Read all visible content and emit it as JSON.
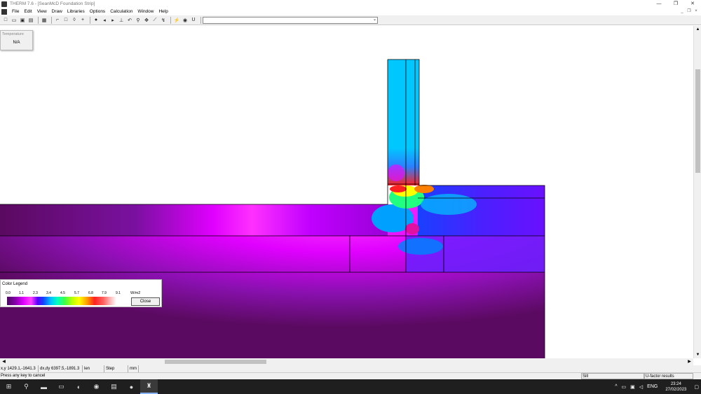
{
  "window": {
    "title": "THERM 7.6 - [SeanMcD Foundation Strip]",
    "controls": [
      "—",
      "❐",
      "✕"
    ]
  },
  "menu": {
    "items": [
      "File",
      "Edit",
      "View",
      "Draw",
      "Libraries",
      "Options",
      "Calculation",
      "Window",
      "Help"
    ],
    "mdi_controls": [
      "_",
      "❐",
      "×"
    ]
  },
  "toolbar": {
    "combo_value": ""
  },
  "temperature_popup": {
    "title": "Temperature",
    "value": "N/A"
  },
  "legend": {
    "title": "Color Legend",
    "ticks": [
      "0.0",
      "1.1",
      "2.3",
      "3.4",
      "4.5",
      "5.7",
      "6.8",
      "7.9",
      "9.1"
    ],
    "units": "W/m2",
    "close_label": "Close"
  },
  "status": {
    "xy": "x,y 1429.1,-1641.3",
    "dxdy": "dx,dy 6397.5,-1891.3",
    "len": "len 6671.3",
    "step": "Step 4000.0",
    "unit": "mm",
    "message": "Press any key to cancel",
    "material": "Sill",
    "result": "U-factor results"
  },
  "taskbar": {
    "lang": "ENG",
    "time": "23:24",
    "date": "27/02/2023"
  },
  "colors": {
    "accent_purple": "#8a00b0",
    "cyan": "#00c8ff",
    "magenta": "#e000ff"
  }
}
